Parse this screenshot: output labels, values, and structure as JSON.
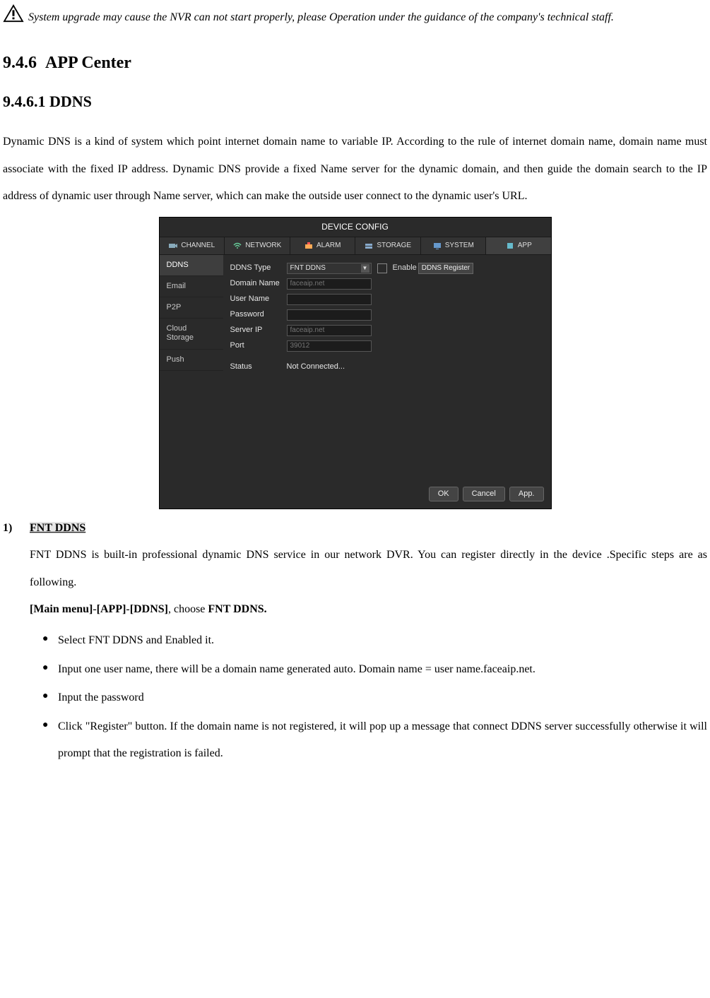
{
  "warning": {
    "text": "System upgrade may cause the NVR can not start properly, please Operation under the guidance of the company's technical staff."
  },
  "section946": {
    "number": "9.4.6",
    "title": "APP Center"
  },
  "section9461": {
    "number": "9.4.6.1",
    "title": "DDNS"
  },
  "intro_para": "Dynamic DNS is a kind of system which point internet domain name to variable IP. According to the rule of internet domain name, domain name must associate with the fixed IP address. Dynamic DNS provide a fixed Name server for the dynamic domain, and then guide the domain search to the IP address of dynamic user through Name server, which can make the outside user connect to the dynamic user's URL.",
  "device_panel": {
    "title": "DEVICE CONFIG",
    "tabs": {
      "channel": "CHANNEL",
      "network": "NETWORK",
      "alarm": "ALARM",
      "storage": "STORAGE",
      "system": "SYSTEM",
      "app": "APP"
    },
    "sidebar": {
      "ddns": "DDNS",
      "email": "Email",
      "p2p": "P2P",
      "cloud": "Cloud Storage",
      "push": "Push"
    },
    "form": {
      "ddns_type_label": "DDNS Type",
      "ddns_type_value": "FNT DDNS",
      "enable_label": "Enable",
      "register_btn": "DDNS Register",
      "domain_name_label": "Domain Name",
      "domain_name_placeholder": "faceaip.net",
      "user_name_label": "User Name",
      "password_label": "Password",
      "server_ip_label": "Server IP",
      "server_ip_placeholder": "faceaip.net",
      "port_label": "Port",
      "port_placeholder": "39012",
      "status_label": "Status",
      "status_value": "Not Connected..."
    },
    "buttons": {
      "ok": "OK",
      "cancel": "Cancel",
      "app": "App."
    }
  },
  "list": {
    "num1": "1)",
    "title1": "FNT DDNS",
    "p1": "FNT DDNS is built-in professional dynamic DNS service in our network DVR. You can register directly in the device .Specific steps are as following.",
    "path_prefix": "[Main menu]",
    "path_sep1": "-",
    "path_app": "[APP]",
    "path_sep2": "-",
    "path_ddns": "[DDNS]",
    "path_mid": ", choose ",
    "path_choice": "FNT DDNS.",
    "bullets": {
      "b1": "Select FNT DDNS and Enabled it.",
      "b2": "Input one user name, there will be a domain name generated auto. Domain name = user name.faceaip.net.",
      "b3": "Input the password",
      "b4": "Click \"Register\" button. If the domain name is not registered, it will pop up a message that connect DDNS server successfully otherwise it will prompt that the registration is failed."
    }
  }
}
